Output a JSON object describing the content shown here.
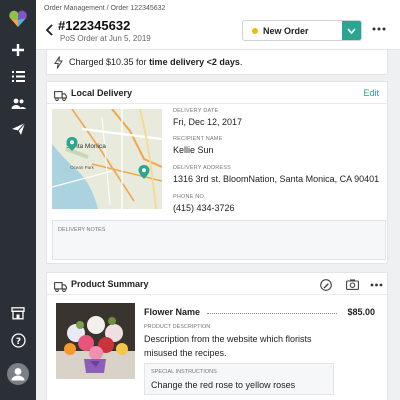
{
  "breadcrumb": {
    "root": "Order Management",
    "separator": " / ",
    "current": "Order 122345632"
  },
  "order": {
    "number": "#122345632",
    "subtitle": "PoS Order at Jun 5, 2019"
  },
  "status": {
    "label": "New Order",
    "dot_color": "#f1b70e"
  },
  "banner": {
    "prefix": "Charged $10.35 for ",
    "emphasis": "time delivery <2 days",
    "suffix": "."
  },
  "delivery": {
    "title": "Local Delivery",
    "edit_label": "Edit",
    "date_label": "DELIVERY DATE",
    "date": "Fri, Dec 12, 2017",
    "recipient_label": "RECIPIENT NAME",
    "recipient": "Kellie Sun",
    "address_label": "DELIVERY ADDRESS",
    "address": "1316 3rd st. BloomNation, Santa Monica, CA 90401",
    "phone_label": "PHONE NO.",
    "phone": "(415) 434-3726",
    "notes_label": "DELIVERY NOTES",
    "map_city": "Santa Monica",
    "map_area": "Ocean Park"
  },
  "product": {
    "title": "Product Summary",
    "name": "Flower Name",
    "price": "$85.00",
    "desc_label": "PRODUCT DESCRIPTION",
    "description": "Description from the website which florists misused the recipes.",
    "special_label": "SPECIAL INSTRUCTIONS",
    "special": "Change the red rose to yellow roses"
  },
  "icons": {
    "sidebar": [
      "heart-logo",
      "plus-icon",
      "list-icon",
      "users-icon",
      "send-icon",
      "store-icon",
      "help-icon",
      "avatar-icon"
    ],
    "header": [
      "back-arrow-icon",
      "chevron-down-icon",
      "more-icon"
    ],
    "cards": [
      "bolt-icon",
      "truck-icon",
      "edit-pen-icon",
      "camera-icon",
      "more-icon"
    ]
  },
  "colors": {
    "accent": "#2aa590",
    "sidebar": "#2b2f36",
    "status_dot": "#f1b70e",
    "map_pin": "#2aa590"
  }
}
